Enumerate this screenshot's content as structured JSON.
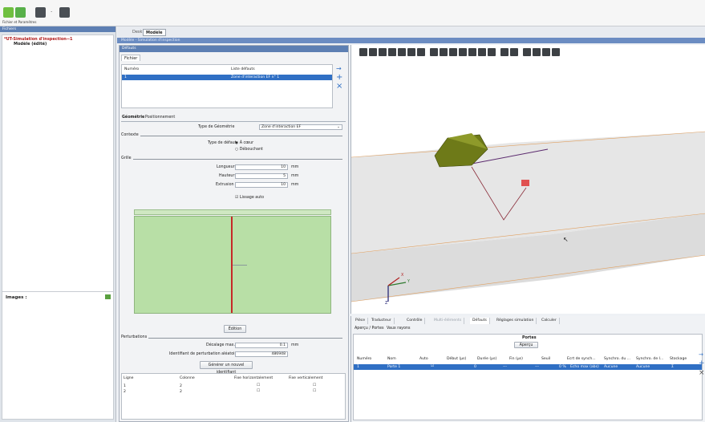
{
  "ribbon": {
    "label": "Fichier et Paramètres"
  },
  "left": {
    "header": "Fichiers",
    "tree": {
      "root": "*UT-Simulation d'inspection--1",
      "child": "Modèle (édité)"
    },
    "images_label": "Images :"
  },
  "tabs": {
    "desk": "Desk",
    "modele": "Modèle"
  },
  "main_header": "Modèle - Simulation d'inspection",
  "defauts": {
    "header": "Défauts",
    "file_tab": "Fichier",
    "table": {
      "col1": "Numéro",
      "col2": "Liste défauts",
      "row_num": "1",
      "row_name": "Zone d'interaction EF n° 1"
    },
    "subtabs": {
      "geometrie": "Géométrie",
      "positionnement": "Positionnement"
    },
    "type_geo_label": "Type de Géométrie",
    "type_geo_value": "Zone d'interaction EF",
    "contexte": "Contexte",
    "type_defaut_label": "Type de défaut",
    "radio_coeur": "À cœur",
    "radio_debouchant": "Débouchant",
    "grille": "Grille",
    "longueur_label": "Longueur",
    "longueur_value": "10",
    "longueur_unit": "mm",
    "hauteur_label": "Hauteur",
    "hauteur_value": "5",
    "hauteur_unit": "mm",
    "extrusion_label": "Extrusion",
    "extrusion_value": "10",
    "extrusion_unit": "mm",
    "lissage_label": "Lissage auto",
    "edition_button": "Édition",
    "perturbations": "Perturbations",
    "decalage_label": "Décalage max.",
    "decalage_value": "0.1",
    "decalage_unit": "mm",
    "ident_label": "Identifiant de perturbation aléatoire",
    "ident_value": "486948",
    "generer_button": "Générer un nouvel identifiant",
    "pert_table": {
      "headers": [
        "Ligne",
        "Colonne",
        "Fixe horizontalement",
        "Fixe verticalement"
      ],
      "rows": [
        [
          "1",
          "2"
        ],
        [
          "2",
          "2"
        ]
      ]
    }
  },
  "bottom": {
    "tabs": [
      "Pièce",
      "Traducteur",
      "Contrôle",
      "Multi-éléments",
      "Défauts",
      "Réglages simulation",
      "Calculer"
    ],
    "subtabs": [
      "Aperçu / Portes",
      "Vaux rayons"
    ],
    "portes_title": "Portes",
    "apercu_button": "Aperçu",
    "columns": [
      "Numéro",
      "Nom",
      "Auto",
      "Début (µs)",
      "Durée (µs)",
      "Fin (µs)",
      "Seuil",
      "Ecrt de synch...",
      "Synchro. du ...",
      "Synchro. de l...",
      "Stockage"
    ],
    "row": [
      "1",
      "Porte 1",
      "",
      "0",
      "---",
      "---",
      "0 %",
      "Echo max (abs)",
      "Aucune",
      "Aucune",
      "Σ"
    ]
  },
  "axes": {
    "x": "X",
    "y": "Y",
    "z": "Z"
  }
}
